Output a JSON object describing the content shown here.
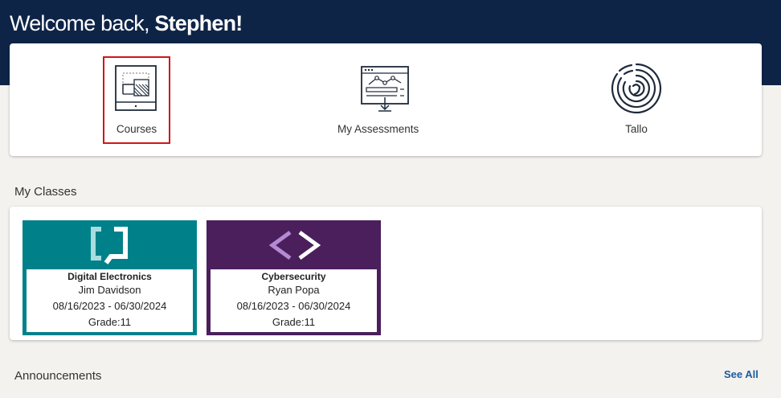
{
  "header": {
    "greeting": "Welcome back,",
    "user_name": "Stephen!"
  },
  "tiles": [
    {
      "label": "Courses",
      "icon": "courses-icon"
    },
    {
      "label": "My Assessments",
      "icon": "assessments-icon"
    },
    {
      "label": "Tallo",
      "icon": "tallo-icon"
    }
  ],
  "my_classes": {
    "title": "My Classes",
    "classes": [
      {
        "name": "Digital Electronics",
        "teacher": "Jim Davidson",
        "dates": "08/16/2023 - 06/30/2024",
        "grade": "Grade:11",
        "color": "#00818a",
        "icon": "bracket-display-icon"
      },
      {
        "name": "Cybersecurity",
        "teacher": "Ryan Popa",
        "dates": "08/16/2023 - 06/30/2024",
        "grade": "Grade:11",
        "color": "#4a1f5c",
        "icon": "code-brackets-icon"
      }
    ]
  },
  "announcements": {
    "title": "Announcements",
    "see_all": "See All"
  },
  "colors": {
    "header_bg": "#0e2447",
    "highlight": "#d0161b",
    "link": "#1b5c9e"
  }
}
